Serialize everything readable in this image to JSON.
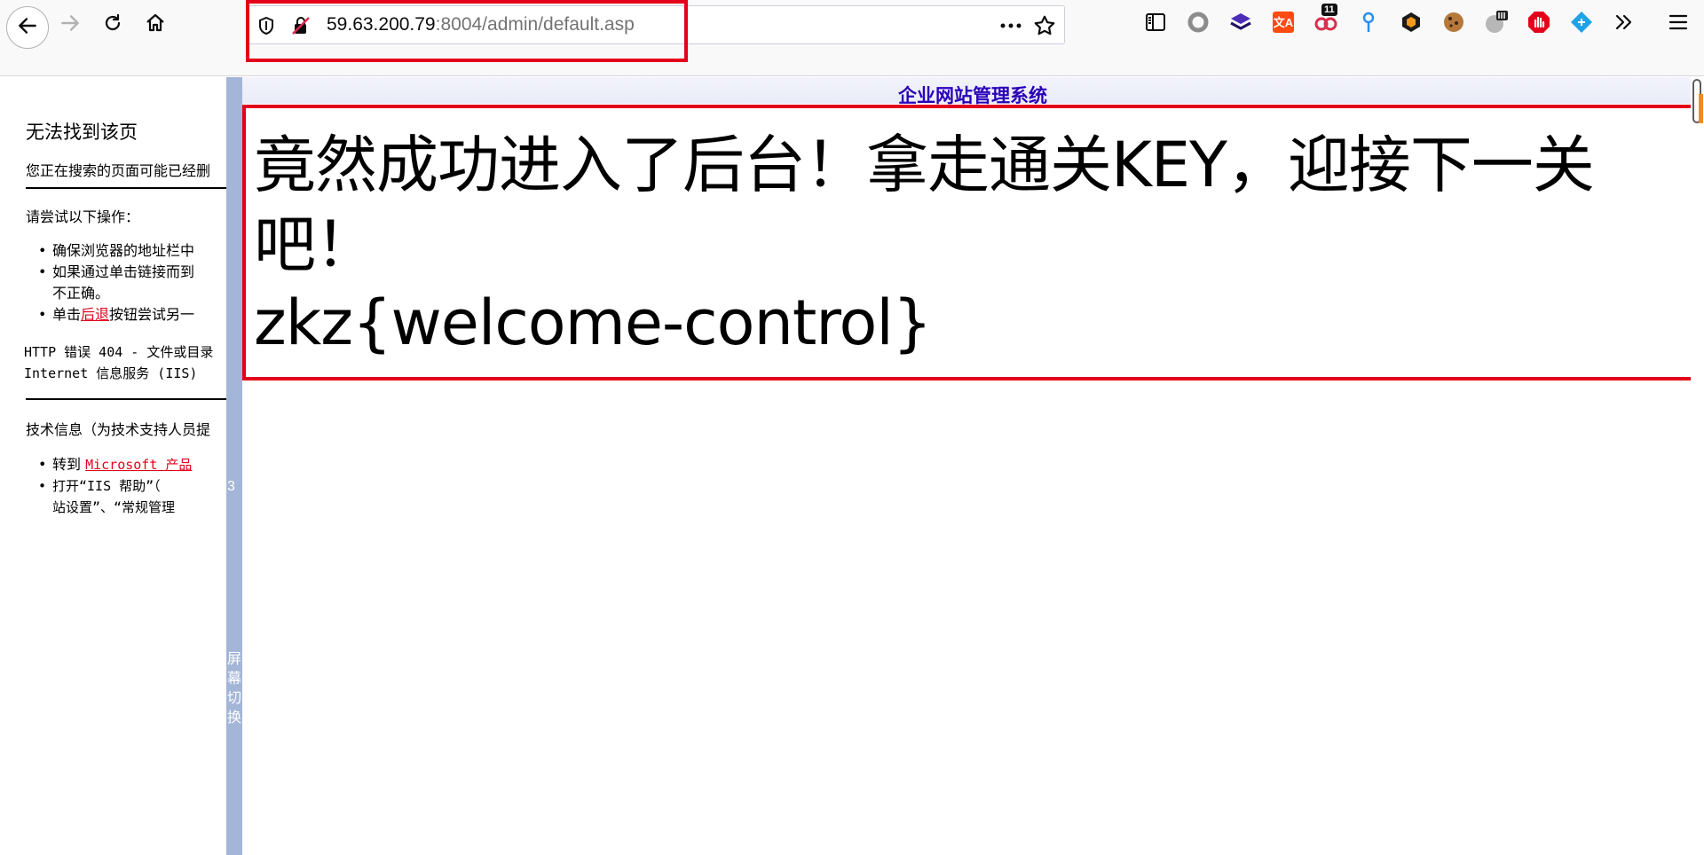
{
  "browser": {
    "url_host": "59.63.200.79",
    "url_rest": ":8004/admin/default.asp",
    "extension_badges": {
      "ext3": "11"
    }
  },
  "left_frame": {
    "title": "无法找到该页",
    "subtitle": "您正在搜索的页面可能已经删",
    "try_heading": "请尝试以下操作：",
    "tips": [
      "确保浏览器的地址栏中",
      "如果通过单击链接而到",
      "不正确。",
      "单击",
      "后退",
      "按钮尝试另一"
    ],
    "error_line1": "HTTP 错误 404 - 文件或目录",
    "error_line2": "Internet 信息服务 (IIS)",
    "tech_heading": "技术信息（为技术支持人员提",
    "tech_goto": "转到 ",
    "tech_link": "Microsoft 产品",
    "tech_open_line1": "打开“IIS 帮助”（",
    "tech_open_line2": "站设置”、“常规管理"
  },
  "switch_bar": {
    "arrow": "3",
    "label": "屏幕切换"
  },
  "main_frame": {
    "title": "企业网站管理系统",
    "message_line1": "竟然成功进入了后台！拿走通关KEY，迎接下一关",
    "message_line2": "吧！",
    "message_key": "zkz{welcome-control}"
  },
  "colors": {
    "highlight": "#e4001b",
    "title_blue": "#2a00b8",
    "switch_bar": "#a4b6d7"
  }
}
